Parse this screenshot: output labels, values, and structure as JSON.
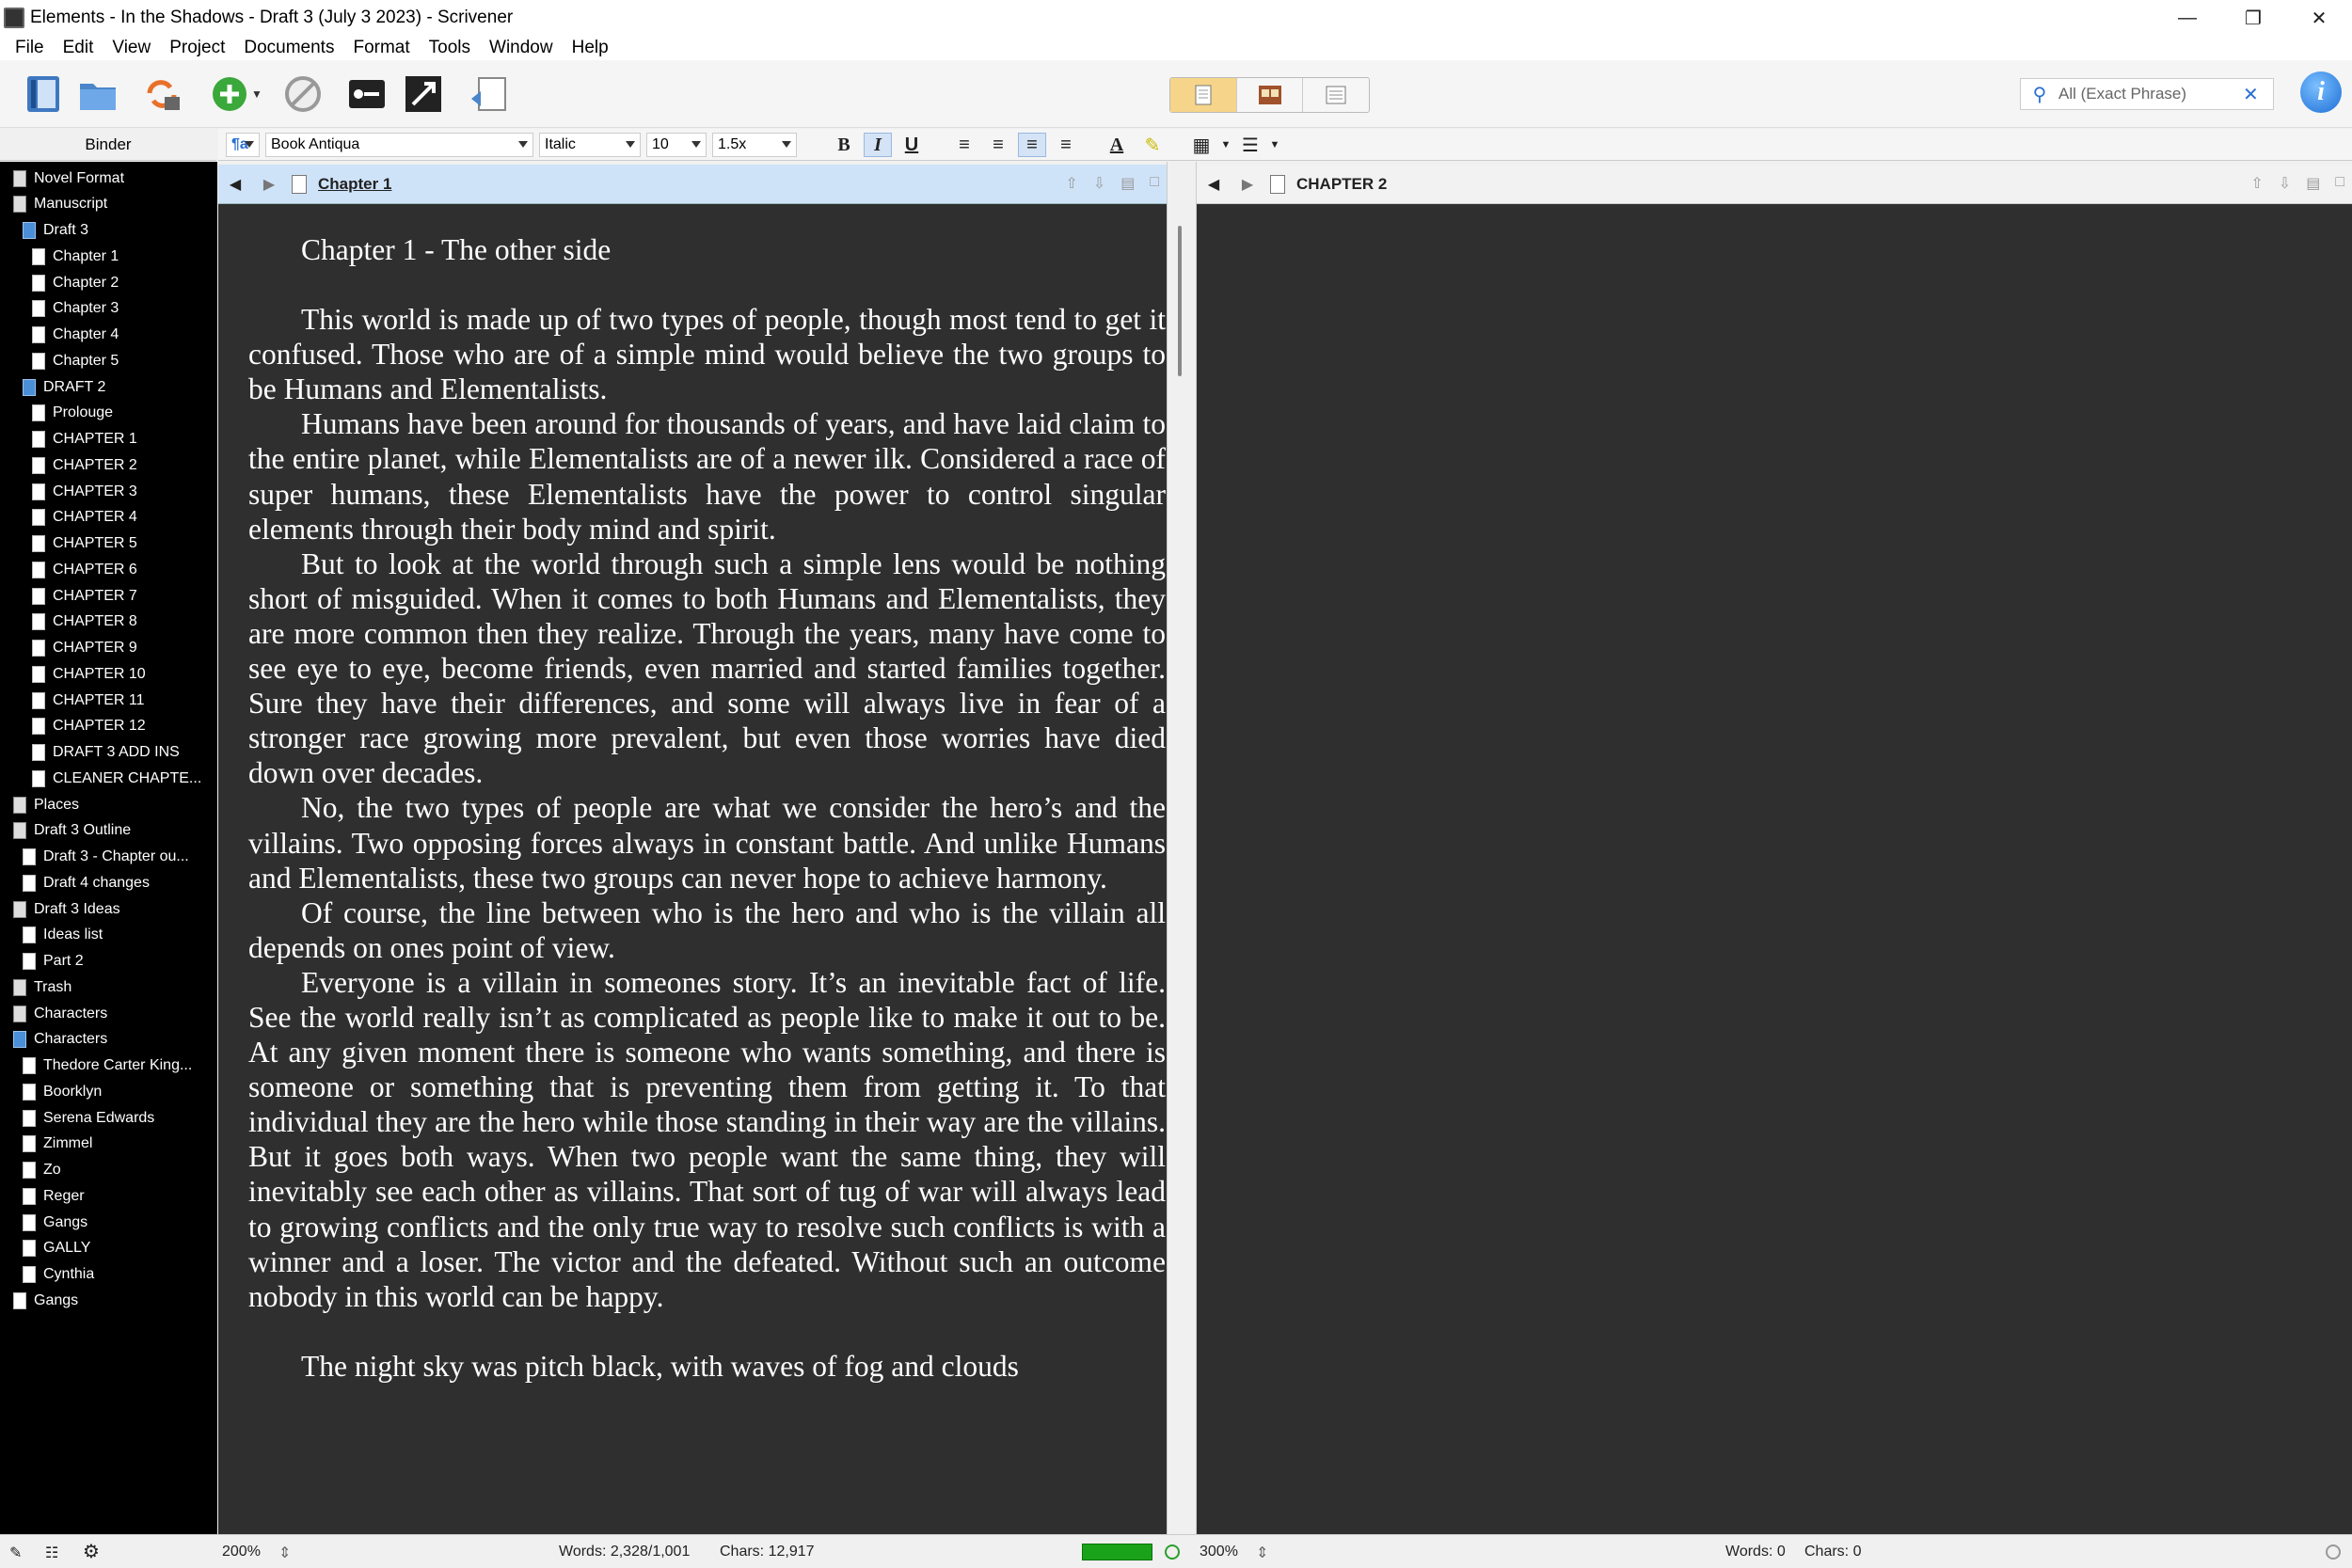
{
  "window": {
    "title": "Elements - In the Shadows - Draft 3 (July 3 2023) - Scrivener"
  },
  "menu": [
    "File",
    "Edit",
    "View",
    "Project",
    "Documents",
    "Format",
    "Tools",
    "Window",
    "Help"
  ],
  "search": {
    "value": "All (Exact Phrase)"
  },
  "binder": {
    "header": "Binder",
    "items": [
      {
        "label": "Novel Format",
        "level": 0,
        "icon": "format-icon"
      },
      {
        "label": "Manuscript",
        "level": 0,
        "icon": "manuscript-icon"
      },
      {
        "label": "Draft 3",
        "level": 1,
        "icon": "folder-icon"
      },
      {
        "label": "Chapter 1",
        "level": 2,
        "icon": "document-icon"
      },
      {
        "label": "Chapter 2",
        "level": 2,
        "icon": "document-icon"
      },
      {
        "label": "Chapter 3",
        "level": 2,
        "icon": "document-icon"
      },
      {
        "label": "Chapter 4",
        "level": 2,
        "icon": "document-icon"
      },
      {
        "label": "Chapter 5",
        "level": 2,
        "icon": "document-icon"
      },
      {
        "label": "DRAFT 2",
        "level": 1,
        "icon": "folder-icon"
      },
      {
        "label": "Prolouge",
        "level": 2,
        "icon": "document-icon"
      },
      {
        "label": "CHAPTER 1",
        "level": 2,
        "icon": "document-icon"
      },
      {
        "label": "CHAPTER 2",
        "level": 2,
        "icon": "document-icon"
      },
      {
        "label": "CHAPTER 3",
        "level": 2,
        "icon": "document-icon"
      },
      {
        "label": "CHAPTER 4",
        "level": 2,
        "icon": "document-icon"
      },
      {
        "label": "CHAPTER 5",
        "level": 2,
        "icon": "document-icon"
      },
      {
        "label": "CHAPTER 6",
        "level": 2,
        "icon": "document-icon"
      },
      {
        "label": "CHAPTER 7",
        "level": 2,
        "icon": "document-icon"
      },
      {
        "label": "CHAPTER 8",
        "level": 2,
        "icon": "document-icon"
      },
      {
        "label": "CHAPTER 9",
        "level": 2,
        "icon": "document-icon"
      },
      {
        "label": "CHAPTER 10",
        "level": 2,
        "icon": "document-icon"
      },
      {
        "label": "CHAPTER 11",
        "level": 2,
        "icon": "document-icon"
      },
      {
        "label": "CHAPTER 12",
        "level": 2,
        "icon": "document-icon"
      },
      {
        "label": "DRAFT 3 ADD INS",
        "level": 2,
        "icon": "document-icon"
      },
      {
        "label": "CLEANER CHAPTE...",
        "level": 2,
        "icon": "document-icon"
      },
      {
        "label": "Places",
        "level": 0,
        "icon": "places-icon"
      },
      {
        "label": "Draft 3 Outline",
        "level": 0,
        "icon": "outline-icon"
      },
      {
        "label": "Draft 3 - Chapter ou...",
        "level": 1,
        "icon": "document-icon"
      },
      {
        "label": "Draft 4 changes",
        "level": 1,
        "icon": "document-icon"
      },
      {
        "label": "Draft 3 Ideas",
        "level": 0,
        "icon": "ideas-icon"
      },
      {
        "label": "Ideas list",
        "level": 1,
        "icon": "document-icon"
      },
      {
        "label": "Part 2",
        "level": 1,
        "icon": "document-icon"
      },
      {
        "label": "Trash",
        "level": 0,
        "icon": "trash-icon"
      },
      {
        "label": "Characters",
        "level": 0,
        "icon": "characters-icon"
      },
      {
        "label": "Characters",
        "level": 0,
        "icon": "folder-icon"
      },
      {
        "label": "Thedore Carter King...",
        "level": 1,
        "icon": "document-icon"
      },
      {
        "label": "Boorklyn",
        "level": 1,
        "icon": "document-icon"
      },
      {
        "label": "Serena Edwards",
        "level": 1,
        "icon": "document-icon"
      },
      {
        "label": "Zimmel",
        "level": 1,
        "icon": "document-icon"
      },
      {
        "label": "Zo",
        "level": 1,
        "icon": "document-icon"
      },
      {
        "label": "Reger",
        "level": 1,
        "icon": "document-icon"
      },
      {
        "label": "Gangs",
        "level": 1,
        "icon": "document-icon"
      },
      {
        "label": "GALLY",
        "level": 1,
        "icon": "document-icon"
      },
      {
        "label": "Cynthia",
        "level": 1,
        "icon": "document-icon"
      },
      {
        "label": "Gangs",
        "level": 0,
        "icon": "document-icon"
      }
    ]
  },
  "format": {
    "style": "¶a",
    "font": "Book Antiqua",
    "typeface": "Italic",
    "size": "10",
    "spacing": "1.5x"
  },
  "editor_left": {
    "title": "Chapter 1",
    "heading": "Chapter 1 - The other side",
    "paragraphs": [
      "This world is made up of two types of people, though most tend to get it confused. Those who are of a simple mind would believe the two groups to be Humans and Elementalists.",
      "Humans have been around for thousands of years, and have laid claim to the entire planet, while Elementalists are of a newer ilk. Considered a race of super humans, these Elementalists have the power to control singular elements through their body mind and spirit.",
      "But to look at the world through such a simple lens would be nothing short of misguided. When it comes to both Humans and Elementalists, they are more common then they realize. Through the years, many have come to see eye to eye, become friends, even married and started families together. Sure they have their differences, and some will always live in fear of a stronger race growing more prevalent, but even those worries have died down over decades.",
      "No, the two types of people are what we consider the hero’s and the villains. Two opposing forces always in constant battle. And unlike Humans and Elementalists, these two groups can never hope to achieve harmony.",
      "Of course, the line between who is the hero and who is the villain all depends on ones point of view.",
      "Everyone is a villain in someones story. It’s an inevitable fact of life. See the world really isn’t as complicated as people like to make it out to be. At any given moment there is someone who wants something, and there is someone or something that is preventing them from getting it. To that individual they are the hero while those standing in their way are the villains. But it goes both ways. When two people want the same thing, they will inevitably see each other as villains. That sort of tug of war will always lead to growing conflicts and the only true way to resolve such conflicts is with a winner and a loser. The victor and the defeated. Without such an outcome nobody in this world can be happy."
    ],
    "trailing": "The night sky was pitch black, with waves of fog and clouds"
  },
  "editor_right": {
    "title": "CHAPTER 2"
  },
  "footer": {
    "left_zoom": "200%",
    "left_words": "Words: 2,328/1,001",
    "left_chars": "Chars: 12,917",
    "target_progress": 1.0,
    "right_zoom": "300%",
    "right_words": "Words: 0",
    "right_chars": "Chars: 0"
  }
}
